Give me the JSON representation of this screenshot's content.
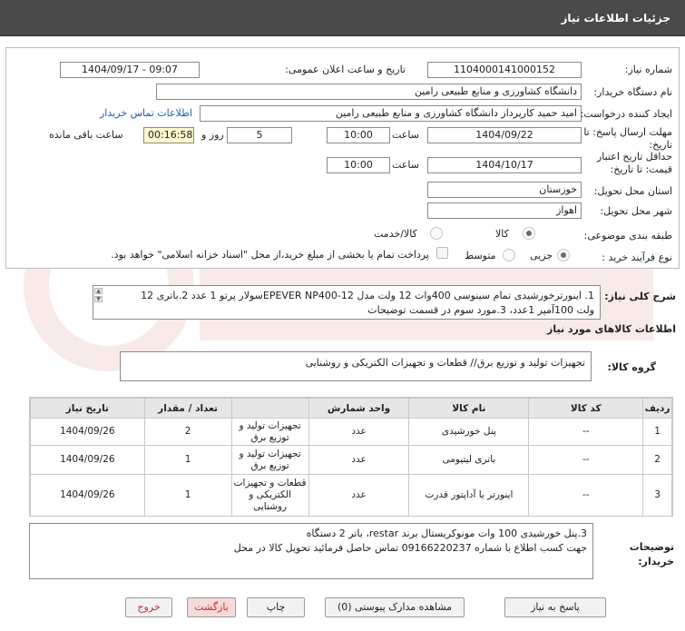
{
  "header": {
    "title": "جزئیات اطلاعات نیاز"
  },
  "form": {
    "need_number_label": "شماره نیاز:",
    "need_number": "1104000141000152",
    "announce_label": "تاریخ و ساعت اعلان عمومی:",
    "announce_value": "1404/09/17 - 09:07",
    "buyer_org_label": "نام دستگاه خریدار:",
    "buyer_org": "دانشگاه کشاورزی و منابع طبیعی رامین",
    "requester_label": "ایجاد کننده درخواست:",
    "requester": "امید حمید کارپرداز دانشگاه کشاورزی و منابع طبیعی رامین",
    "contact_link": "اطلاعات تماس خریدار",
    "reply_deadline_label": "مهلت ارسال پاسخ: تا",
    "reply_deadline_label2": "تاریخ:",
    "reply_date": "1404/09/22",
    "time_label": "ساعت",
    "reply_time": "10:00",
    "days": "5",
    "days_label": "روز و",
    "countdown": "00:16:58",
    "remaining_label": "ساعت باقی مانده",
    "validity_label": "حداقل تاریخ اعتبار",
    "validity_label2": "قیمت: تا تاریخ:",
    "validity_date": "1404/10/17",
    "validity_time": "10:00",
    "province_label": "استان محل تحویل:",
    "province": "خوزستان",
    "city_label": "شهر محل تحویل:",
    "city": "اهواز",
    "category_label": "طبقه بندی موضوعی:",
    "category_options": [
      "کالا",
      "کالا/خدمت"
    ],
    "category_selected": "کالا",
    "process_label": "نوع فرآیند خرید :",
    "process_options": [
      "جزیی",
      "متوسط"
    ],
    "process_selected": "جزیی",
    "payment_note": "پرداخت تمام یا بخشی از مبلغ خرید،از محل \"اسناد خزانه اسلامی\" خواهد بود."
  },
  "need_summary": {
    "label": "شرح کلی نیاز:",
    "line1": "1. اینورترخورشیدی تمام سینوسی 400وات 12 ولت مدل EPEVER NP400-12سولار پرتو 1 عدد  2.باتری 12",
    "line2": "ولت 100آمپر 1عدد، 3.مورد سوم در قسمت توضیحات"
  },
  "goods": {
    "section_title": "اطلاعات کالاهای مورد نیاز",
    "group_label": "گروه کالا:",
    "group_value": "تجهیزات تولید و توزیع برق// قطعات و تجهیزات الکتریکی و روشنایی",
    "columns": [
      "ردیف",
      "کد کالا",
      "نام کالا",
      "واحد شمارش",
      "",
      "تعداد / مقدار",
      "تاریخ نیاز"
    ],
    "rows": [
      {
        "index": "1",
        "code": "--",
        "name": "پنل خورشیدی",
        "unit": "عدد",
        "group": "تجهیزات تولید و توزیع برق",
        "qty": "2",
        "date": "1404/09/26"
      },
      {
        "index": "2",
        "code": "--",
        "name": "باتری لیتیومی",
        "unit": "عدد",
        "group": "تجهیزات تولید و توزیع برق",
        "qty": "1",
        "date": "1404/09/26"
      },
      {
        "index": "3",
        "code": "--",
        "name": "اینورتر یا آداپتور قدرت",
        "unit": "عدد",
        "group": "قطعات و تجهیزات الکتریکی و روشنایی",
        "qty": "1",
        "date": "1404/09/26"
      }
    ]
  },
  "buyer_notes": {
    "label": "توضیحات",
    "label2": "خریدار:",
    "line1": "3.پنل خورشیدی 100 وات مونوکریستال برند restar، باتر 2 دستگاه",
    "line2": "جهت کسب اطلاع با شماره 09166220237 تماس حاصل فرمائید تحویل کالا در محل"
  },
  "buttons": {
    "reply": "پاسخ به نیاز",
    "attachments": "مشاهده مدارک پیوستی (0)",
    "print": "چاپ",
    "back": "بازگشت",
    "exit": "خروج"
  },
  "colors": {
    "header_bg": "#4a4a4a",
    "link": "#1a5fb4",
    "countdown_bg": "#fff7cf",
    "exit_text": "#c62828"
  }
}
